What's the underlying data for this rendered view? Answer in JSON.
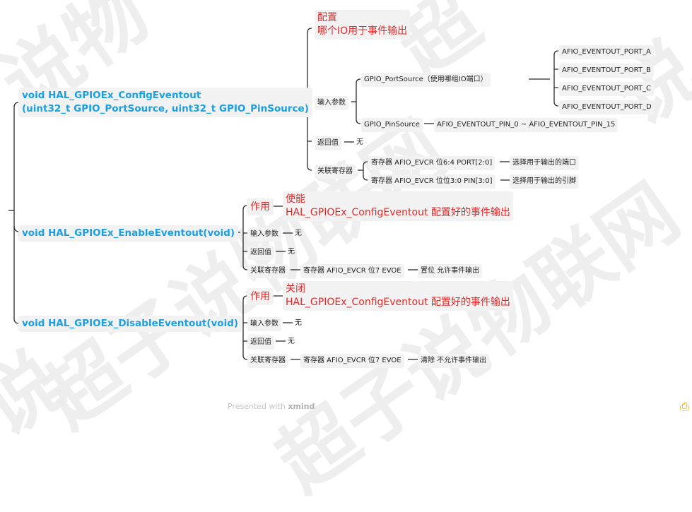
{
  "watermark": [
    "说物",
    "超子说物联网",
    "超子说物联网",
    "说",
    "超",
    "说"
  ],
  "functions": {
    "config": {
      "line1": "void HAL_GPIOEx_ConfigEventout",
      "line2": "(uint32_t GPIO_PortSource, uint32_t GPIO_PinSource)",
      "purpose_l1": "配置",
      "purpose_l2": "哪个IO用于事件输出",
      "input_label": "输入参数",
      "port_source": "GPIO_PortSource（使用哪组IO端口）",
      "ports": [
        "AFIO_EVENTOUT_PORT_A",
        "AFIO_EVENTOUT_PORT_B",
        "AFIO_EVENTOUT_PORT_C",
        "AFIO_EVENTOUT_PORT_D"
      ],
      "pin_source": "GPIO_PinSource",
      "pin_range": "AFIO_EVENTOUT_PIN_0 ~ AFIO_EVENTOUT_PIN_15",
      "return_label": "返回值",
      "return_value": "无",
      "reg_label": "关联寄存器",
      "reg1": "寄存器 AFIO_EVCR 位6:4 PORT[2:0]",
      "reg1_desc": "选择用于输出的端口",
      "reg2": "寄存器 AFIO_EVCR 位位3:0 PIN[3:0]",
      "reg2_desc": "选择用于输出的引脚"
    },
    "enable": {
      "title": "void HAL_GPIOEx_EnableEventout(void)",
      "role_label": "作用",
      "role_l1": "使能",
      "role_l2": "HAL_GPIOEx_ConfigEventout  配置好的事件输出",
      "input_label": "输入参数",
      "input_value": "无",
      "return_label": "返回值",
      "return_value": "无",
      "reg_label": "关联寄存器",
      "reg": "寄存器 AFIO_EVCR 位7 EVOE",
      "reg_desc": "置位 允许事件输出"
    },
    "disable": {
      "title": "void HAL_GPIOEx_DisableEventout(void)",
      "role_label": "作用",
      "role_l1": "关闭",
      "role_l2": "HAL_GPIOEx_ConfigEventout 配置好的事件输出",
      "input_label": "输入参数",
      "input_value": "无",
      "return_label": "返回值",
      "return_value": "无",
      "reg_label": "关联寄存器",
      "reg": "寄存器 AFIO_EVCR 位7 EVOE",
      "reg_desc": "清除 不允许事件输出"
    }
  },
  "footer": {
    "presented": "Presented with",
    "brand": "xmind"
  }
}
